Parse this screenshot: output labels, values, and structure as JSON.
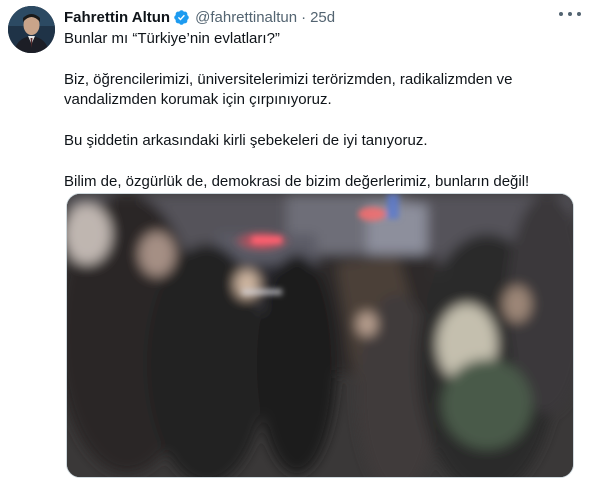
{
  "tweet": {
    "author_name": "Fahrettin Altun",
    "handle": "@fahrettinaltun",
    "separator": "·",
    "time": "25d",
    "paragraphs": [
      "Bunlar mı “Türkiye’nin evlatları?”",
      "Biz, öğrencilerimizi, üniversitelerimizi terörizmden, radikalizmden ve vandalizmden korumak için çırpınıyoruz.",
      "Bu şiddetin arkasındaki kirli şebekeleri de iyi tanıyoruz.",
      "Bilim de, özgürlük de, demokrasi de bizim değerlerimiz, bunların değil!"
    ]
  },
  "colors": {
    "verified": "#1d9bf0",
    "secondary_text": "#536471",
    "primary_text": "#0f1419"
  },
  "icons": {
    "verified": "verified-badge-icon",
    "more": "more-options-icon"
  }
}
